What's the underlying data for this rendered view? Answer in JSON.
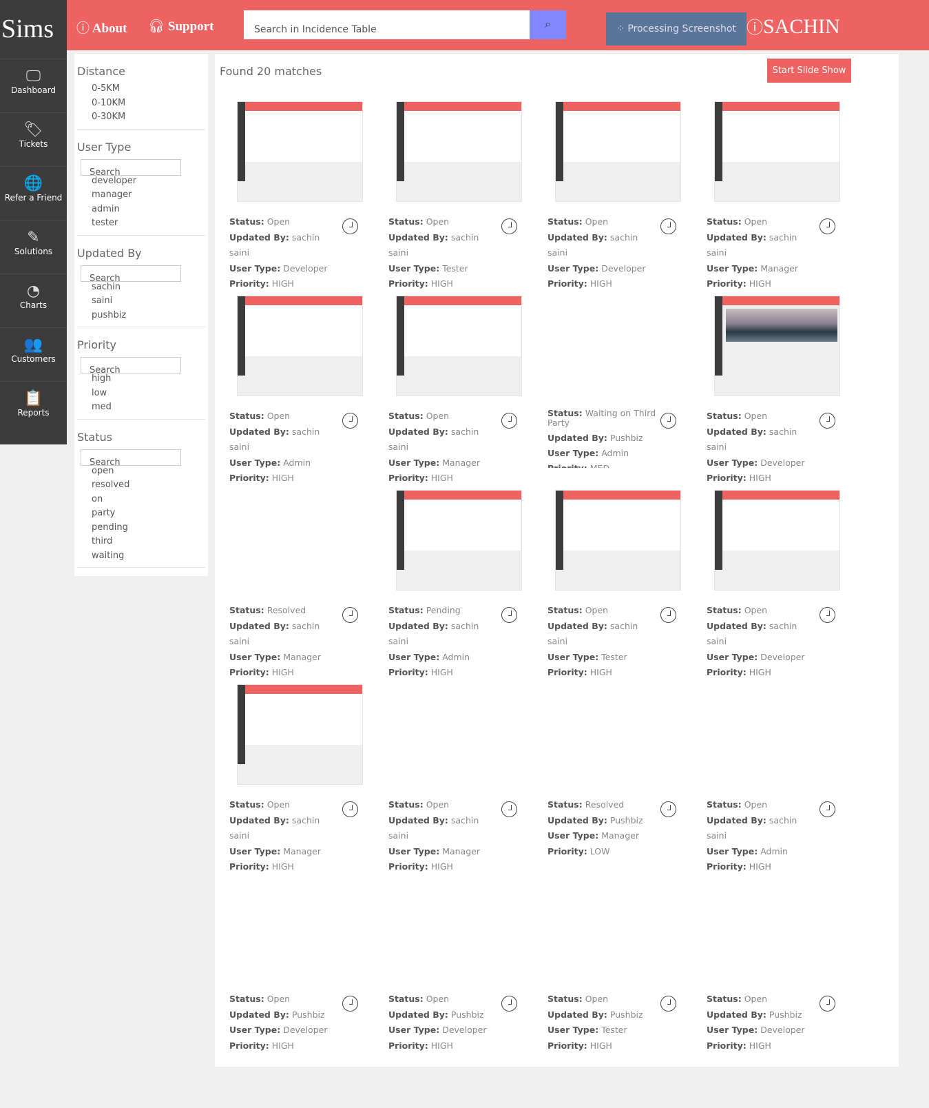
{
  "app": {
    "logo": "Sims"
  },
  "sidebar": {
    "items": [
      {
        "label": "Dashboard",
        "icon": "🖵"
      },
      {
        "label": "Tickets",
        "icon": "🏷"
      },
      {
        "label": "Refer a Friend",
        "icon": "🌐"
      },
      {
        "label": "Solutions",
        "icon": "✎"
      },
      {
        "label": "Charts",
        "icon": "◔"
      },
      {
        "label": "Customers",
        "icon": "👥"
      },
      {
        "label": "Reports",
        "icon": "📋"
      }
    ]
  },
  "header": {
    "about": "About",
    "support": "Support",
    "search_placeholder": "Search in Incidence Table",
    "processing": "Processing Screenshot",
    "user": "SACHIN"
  },
  "filters": [
    {
      "title": "Distance",
      "search": null,
      "options": [
        "0-5KM",
        "0-10KM",
        "0-30KM"
      ]
    },
    {
      "title": "User Type",
      "search": "Search",
      "options": [
        "developer",
        "manager",
        "admin",
        "tester"
      ]
    },
    {
      "title": "Updated By",
      "search": "Search",
      "options": [
        "sachin",
        "saini",
        "pushbiz"
      ]
    },
    {
      "title": "Priority",
      "search": "Search",
      "options": [
        "high",
        "low",
        "med"
      ]
    },
    {
      "title": "Status",
      "search": "Search",
      "options": [
        "open",
        "resolved",
        "on",
        "party",
        "pending",
        "third",
        "waiting"
      ]
    }
  ],
  "main": {
    "found": "Found 20 matches",
    "slideshow": "Start Slide Show",
    "labels": {
      "status": "Status:",
      "updated": "Updated By:",
      "usertype": "User Type:",
      "priority": "Priority:"
    },
    "cards": [
      {
        "status": "Open",
        "updated": "sachin saini",
        "usertype": "Developer",
        "priority": "HIGH",
        "thumbnail": "screenshot"
      },
      {
        "status": "Open",
        "updated": "sachin saini",
        "usertype": "Tester",
        "priority": "HIGH",
        "thumbnail": "screenshot"
      },
      {
        "status": "Open",
        "updated": "sachin saini",
        "usertype": "Developer",
        "priority": "HIGH",
        "thumbnail": "screenshot"
      },
      {
        "status": "Open",
        "updated": "sachin saini",
        "usertype": "Manager",
        "priority": "HIGH",
        "thumbnail": "screenshot"
      },
      {
        "status": "Open",
        "updated": "sachin saini",
        "usertype": "Admin",
        "priority": "HIGH",
        "thumbnail": "screenshot"
      },
      {
        "status": "Open",
        "updated": "sachin saini",
        "usertype": "Manager",
        "priority": "HIGH",
        "thumbnail": "screenshot"
      },
      {
        "status": "Waiting on Third Party",
        "updated": "Pushbiz",
        "usertype": "Admin",
        "priority": "MED",
        "thumbnail": null
      },
      {
        "status": "Open",
        "updated": "sachin saini",
        "usertype": "Developer",
        "priority": "HIGH",
        "thumbnail": "photo"
      },
      {
        "status": "Resolved",
        "updated": "sachin saini",
        "usertype": "Manager",
        "priority": "HIGH",
        "thumbnail": null
      },
      {
        "status": "Pending",
        "updated": "sachin saini",
        "usertype": "Admin",
        "priority": "HIGH",
        "thumbnail": "screenshot"
      },
      {
        "status": "Open",
        "updated": "sachin saini",
        "usertype": "Tester",
        "priority": "HIGH",
        "thumbnail": "screenshot"
      },
      {
        "status": "Open",
        "updated": "sachin saini",
        "usertype": "Developer",
        "priority": "HIGH",
        "thumbnail": "screenshot"
      },
      {
        "status": "Open",
        "updated": "sachin saini",
        "usertype": "Manager",
        "priority": "HIGH",
        "thumbnail": "screenshot"
      },
      {
        "status": "Open",
        "updated": "sachin saini",
        "usertype": "Manager",
        "priority": "HIGH",
        "thumbnail": null
      },
      {
        "status": "Resolved",
        "updated": "Pushbiz",
        "usertype": "Manager",
        "priority": "LOW",
        "thumbnail": null
      },
      {
        "status": "Open",
        "updated": "sachin saini",
        "usertype": "Admin",
        "priority": "HIGH",
        "thumbnail": null
      },
      {
        "status": "Open",
        "updated": "Pushbiz",
        "usertype": "Developer",
        "priority": "HIGH",
        "thumbnail": null
      },
      {
        "status": "Open",
        "updated": "Pushbiz",
        "usertype": "Developer",
        "priority": "HIGH",
        "thumbnail": null
      },
      {
        "status": "Open",
        "updated": "Pushbiz",
        "usertype": "Tester",
        "priority": "HIGH",
        "thumbnail": null
      },
      {
        "status": "Open",
        "updated": "Pushbiz",
        "usertype": "Developer",
        "priority": "HIGH",
        "thumbnail": null
      }
    ]
  }
}
